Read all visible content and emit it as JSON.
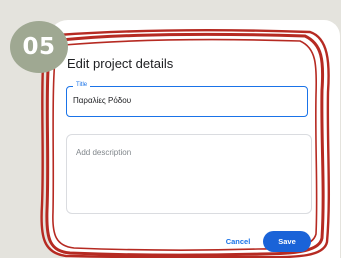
{
  "step_badge": "05",
  "dialog": {
    "title": "Edit project details",
    "title_field": {
      "label": "Title",
      "value": "Παραλίες Ρόδου"
    },
    "description_field": {
      "placeholder": "Add description"
    },
    "cancel_label": "Cancel",
    "save_label": "Save"
  },
  "colors": {
    "accent": "#1a73e8",
    "highlight_frame": "#b62a22",
    "badge": "#9fa892",
    "background": "#e4e3dd"
  }
}
